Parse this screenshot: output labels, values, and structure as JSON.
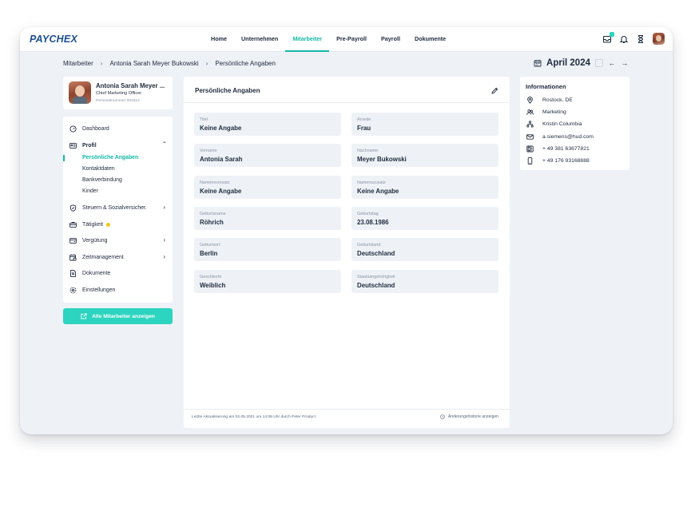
{
  "header": {
    "logo": "PAYCHEX",
    "nav": [
      "Home",
      "Unternehmen",
      "Mitarbeiter",
      "Pre-Payroll",
      "Payroll",
      "Dokumente"
    ],
    "active_nav": "Mitarbeiter"
  },
  "breadcrumb": {
    "items": [
      "Mitarbeiter",
      "Antonia Sarah Meyer Bukowski",
      "Persönliche Angaben"
    ],
    "separator": "›"
  },
  "period": {
    "label": "April 2024",
    "prev": "←",
    "next": "→"
  },
  "profile": {
    "name": "Antonia Sarah Meyer ...",
    "role": "Chief Marketing Officer",
    "personnel_number": "Personalnummer 001612"
  },
  "sidebar": {
    "items": [
      {
        "label": "Dashboard"
      },
      {
        "label": "Profil"
      },
      {
        "label": "Steuern & Sozialversicher."
      },
      {
        "label": "Tätigkeit"
      },
      {
        "label": "Vergütung"
      },
      {
        "label": "Zeitmanagement"
      },
      {
        "label": "Dokumente"
      },
      {
        "label": "Einstellungen"
      }
    ],
    "profile_subitems": [
      "Persönliche Angaben",
      "Kontaktdaten",
      "Bankverbindung",
      "Kinder"
    ],
    "cta_label": "Alle Mitarbeiter anzeigen"
  },
  "main": {
    "title": "Persönliche Angaben",
    "fields": [
      {
        "label": "Titel",
        "value": "Keine Angabe"
      },
      {
        "label": "Anrede",
        "value": "Frau"
      },
      {
        "label": "Vorname",
        "value": "Antonia Sarah"
      },
      {
        "label": "Nachname",
        "value": "Meyer Bukowski"
      },
      {
        "label": "Namensvorsatz",
        "value": "Keine Angabe"
      },
      {
        "label": "Namenszusatz",
        "value": "Keine Angabe"
      },
      {
        "label": "Geburtsname",
        "value": "Röhrich"
      },
      {
        "label": "Geburtstag",
        "value": "23.08.1986"
      },
      {
        "label": "Geburtsort",
        "value": "Berlin"
      },
      {
        "label": "Geburtsland",
        "value": "Deutschland"
      },
      {
        "label": "Geschlecht",
        "value": "Weiblich"
      },
      {
        "label": "Staatsangehörigkeit",
        "value": "Deutschland"
      }
    ],
    "footer_left": "Letzte Aktualisierung am 02.05.2021 um 14:08 Uhr durch Peter Product",
    "footer_right": "Änderungshistorie anzeigen"
  },
  "info": {
    "title": "Informationen",
    "location": "Rostock, DE",
    "department": "Marketing",
    "manager": "Kristin Columbia",
    "email": "a.siemens@hud.com",
    "phone": "+ 49 381 63677821",
    "mobile": "+ 49 176 93168888"
  },
  "colors": {
    "accent": "#2dd4bf",
    "accent_text": "#14b8a6",
    "brand": "#1d4f91",
    "background": "#eef2f7"
  }
}
